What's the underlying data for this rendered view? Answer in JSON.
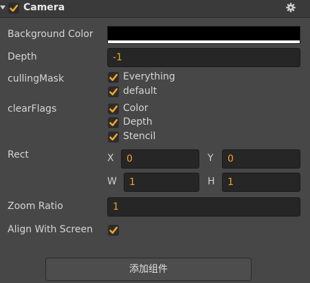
{
  "component": {
    "title": "Camera",
    "enabled": true
  },
  "fields": {
    "background_color": {
      "label": "Background Color",
      "color": "#000000",
      "alpha_color": "#ffffff"
    },
    "depth": {
      "label": "Depth",
      "value": "-1"
    },
    "culling_mask": {
      "label": "cullingMask",
      "options": [
        {
          "label": "Everything",
          "checked": true
        },
        {
          "label": "default",
          "checked": true
        }
      ]
    },
    "clear_flags": {
      "label": "clearFlags",
      "options": [
        {
          "label": "Color",
          "checked": true
        },
        {
          "label": "Depth",
          "checked": true
        },
        {
          "label": "Stencil",
          "checked": true
        }
      ]
    },
    "rect": {
      "label": "Rect",
      "x_label": "X",
      "x": "0",
      "y_label": "Y",
      "y": "0",
      "w_label": "W",
      "w": "1",
      "h_label": "H",
      "h": "1"
    },
    "zoom_ratio": {
      "label": "Zoom Ratio",
      "value": "1"
    },
    "align_with_screen": {
      "label": "Align With Screen",
      "checked": true
    }
  },
  "add_component_button": {
    "label": "添加组件"
  },
  "icons": {
    "collapse": "caret-down-icon",
    "settings": "gear-icon",
    "check": "checkmark-icon"
  },
  "colors": {
    "accent": "#f5a623",
    "panel_bg": "#474747",
    "header_bg": "#3a3a3a",
    "input_bg": "#262626"
  }
}
